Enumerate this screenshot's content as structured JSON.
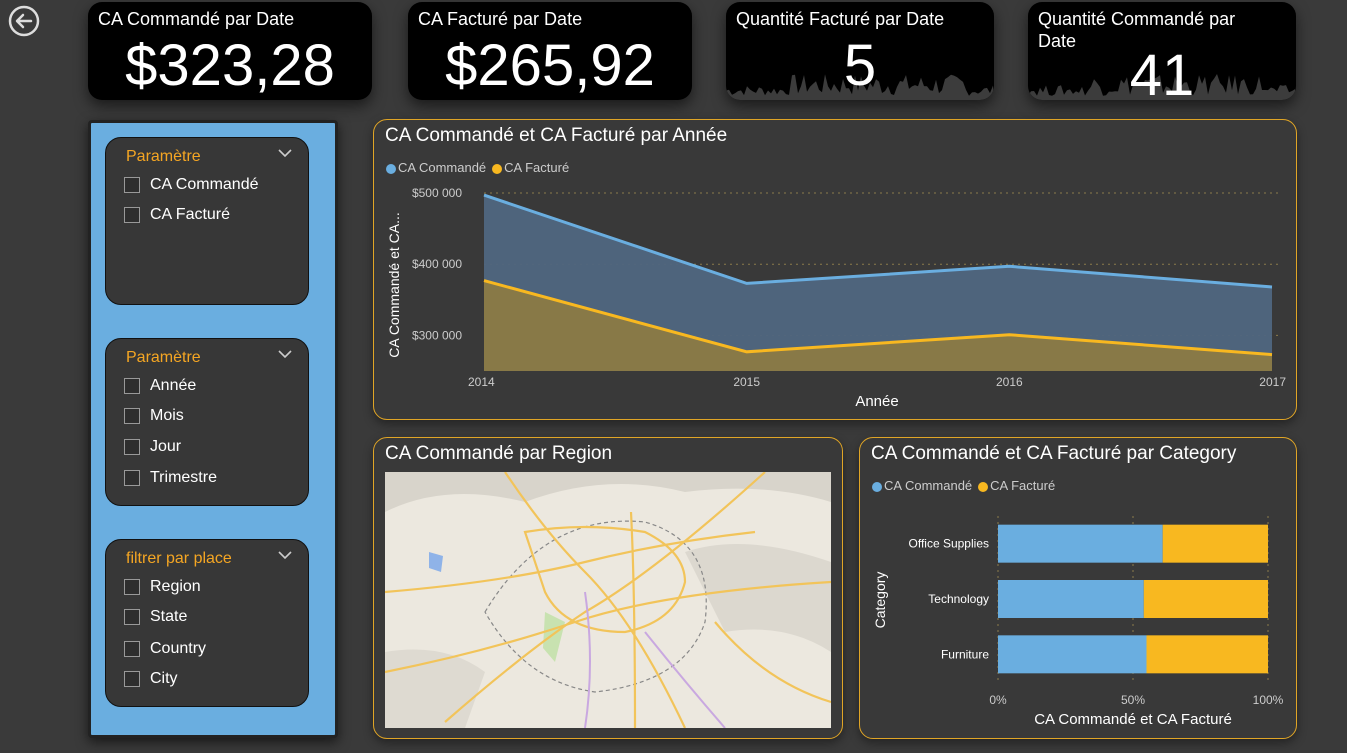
{
  "kpis": [
    {
      "title": "CA Commandé par Date",
      "value": "$323,28"
    },
    {
      "title": "CA Facturé par Date",
      "value": "$265,92"
    },
    {
      "title": "Quantité Facturé par Date",
      "value": "5"
    },
    {
      "title": "Quantité Commandé par Date",
      "value": "41"
    }
  ],
  "slicers": [
    {
      "header": "Paramètre",
      "options": [
        "CA Commandé",
        "CA Facturé"
      ]
    },
    {
      "header": "Paramètre",
      "options": [
        "Année",
        "Mois",
        "Jour",
        "Trimestre"
      ]
    },
    {
      "header": "filtrer par place",
      "options": [
        "Region",
        "State",
        "Country",
        "City"
      ]
    }
  ],
  "line_panel": {
    "title": "CA Commandé et CA Facturé par Année"
  },
  "map_panel": {
    "title": "CA Commandé par Region"
  },
  "bar_panel": {
    "title": "CA Commandé et CA Facturé par Category"
  },
  "colors": {
    "commande": "#6aaee0",
    "facture": "#f8b820",
    "accent": "#f5a623",
    "panel_border": "#e0a526"
  },
  "chart_data": [
    {
      "type": "area",
      "title": "CA Commandé et CA Facturé par Année",
      "xlabel": "Année",
      "ylabel": "CA Commandé et CA...",
      "x": [
        "2014",
        "2015",
        "2016",
        "2017"
      ],
      "series": [
        {
          "name": "CA Commandé",
          "values": [
            497000,
            373000,
            397000,
            368000
          ]
        },
        {
          "name": "CA Facturé",
          "values": [
            377000,
            277000,
            301000,
            273000
          ]
        }
      ],
      "yticks": [
        "$300 000",
        "$400 000",
        "$500 000"
      ],
      "ytick_values": [
        300000,
        400000,
        500000
      ],
      "ylim": [
        250000,
        500000
      ],
      "grid": true,
      "legend": "top-left"
    },
    {
      "type": "bar",
      "title": "CA Commandé et CA Facturé par Category",
      "xlabel": "CA Commandé et CA Facturé",
      "ylabel": "Category",
      "categories": [
        "Office Supplies",
        "Technology",
        "Furniture"
      ],
      "series": [
        {
          "name": "CA Commandé",
          "values": [
            61,
            54,
            55
          ]
        },
        {
          "name": "CA Facturé",
          "values": [
            39,
            46,
            45
          ]
        }
      ],
      "xticks": [
        "0%",
        "50%",
        "100%"
      ],
      "xlim": [
        0,
        100
      ],
      "stacked": "100%",
      "legend": "top-left"
    }
  ]
}
